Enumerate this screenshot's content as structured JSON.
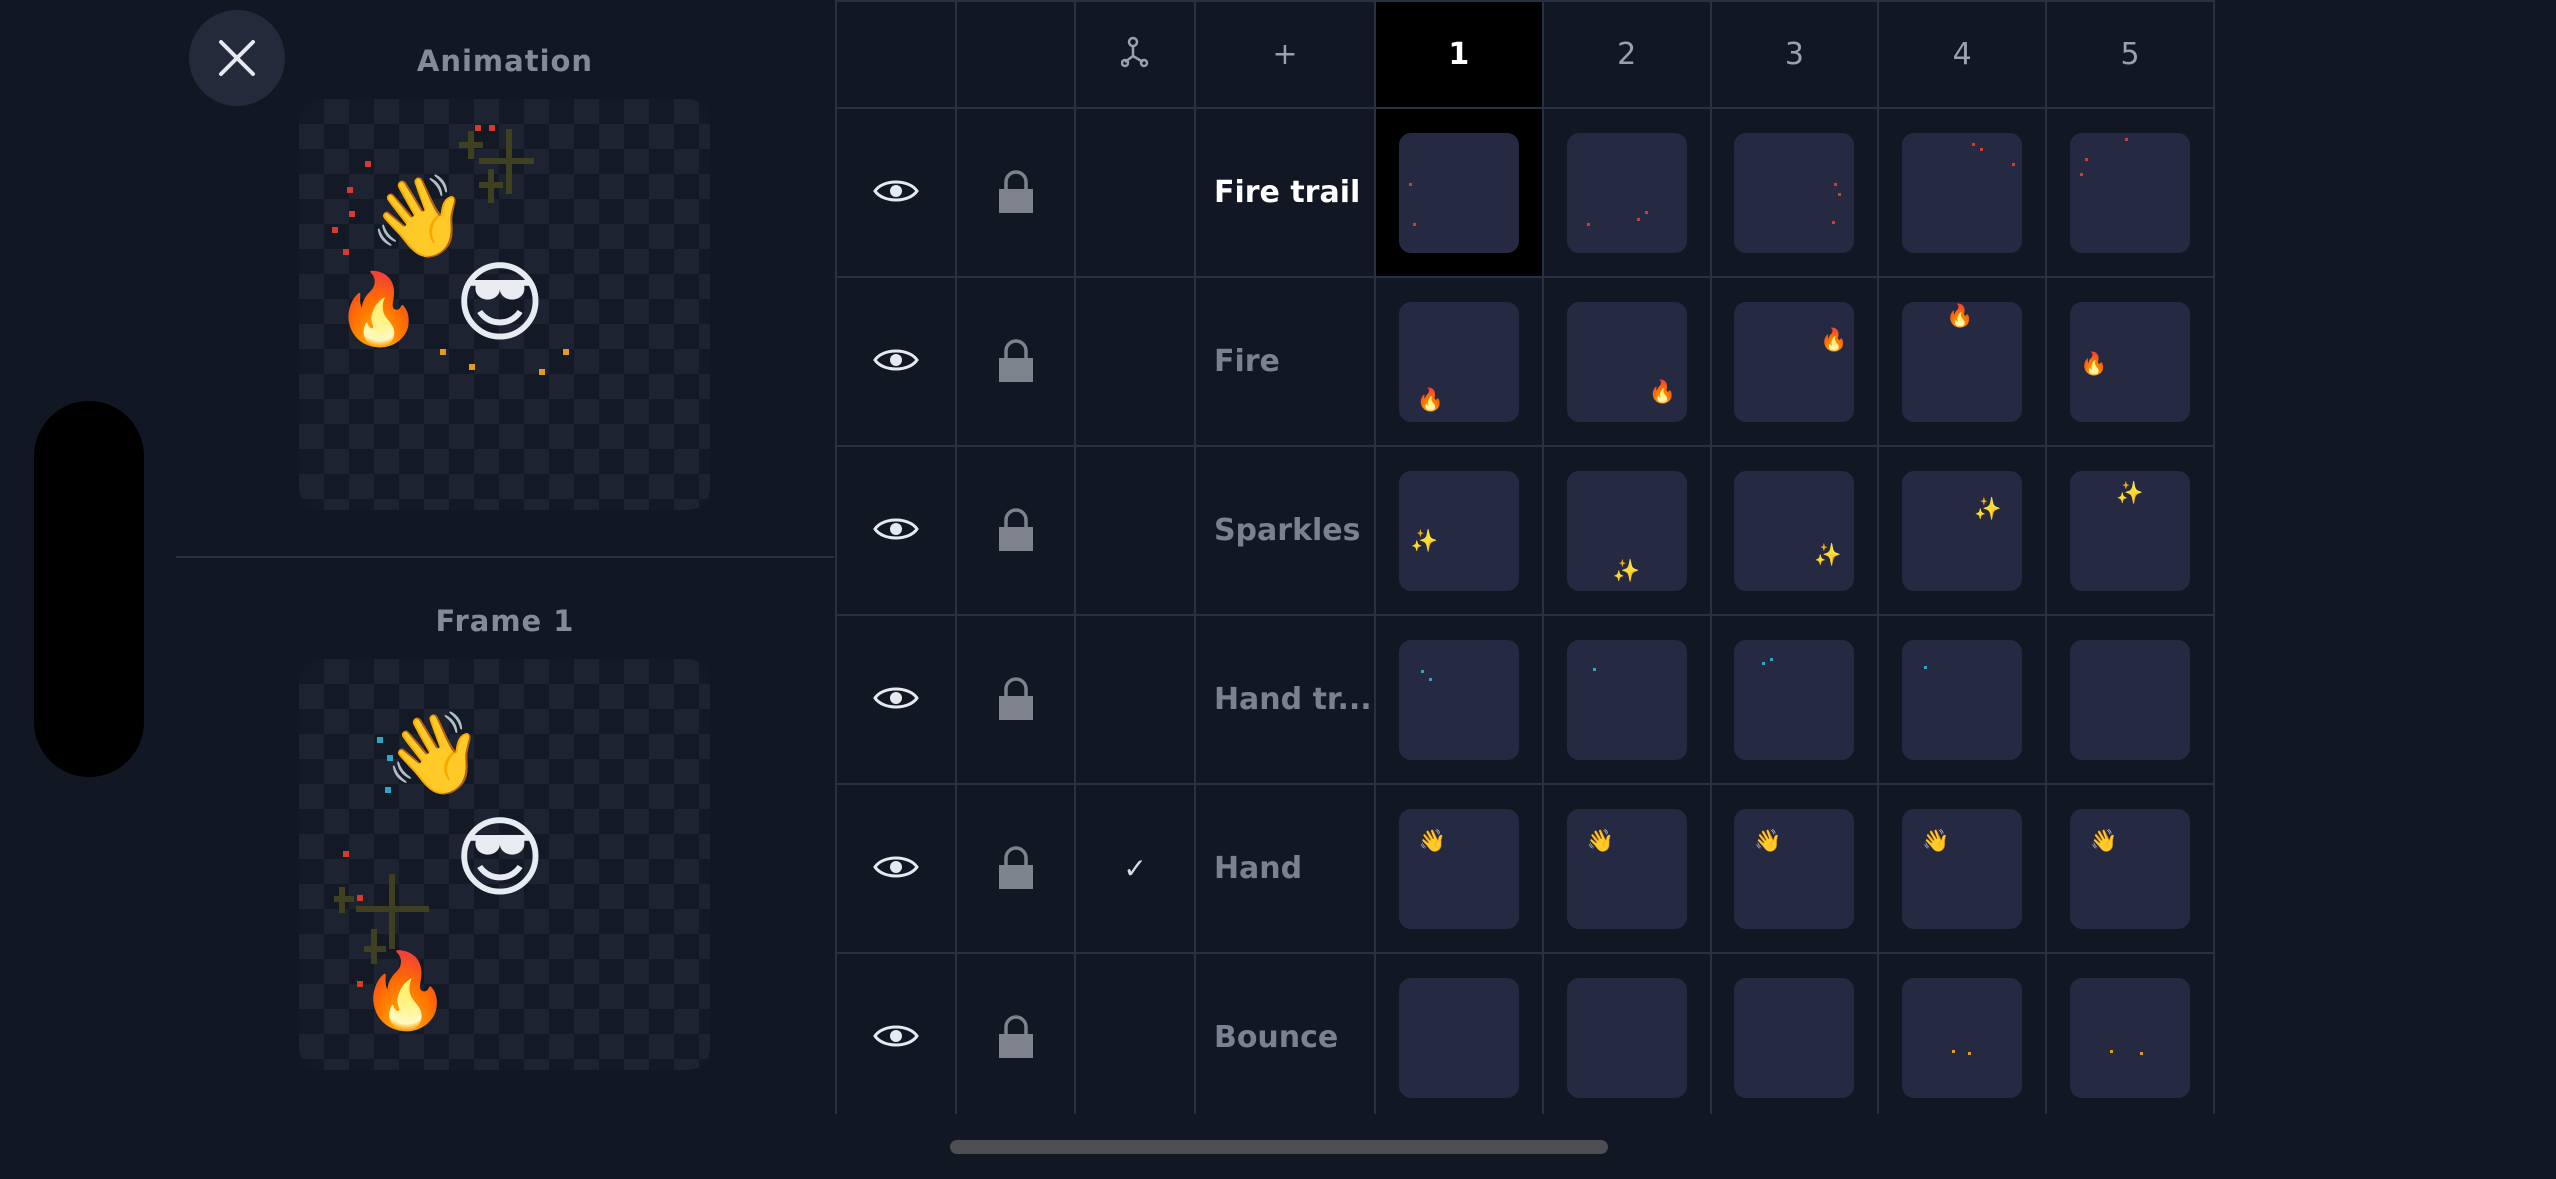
{
  "previews": {
    "animation_title": "Animation",
    "frame_title": "Frame 1"
  },
  "timeline": {
    "frames": [
      "1",
      "2",
      "3",
      "4",
      "5"
    ],
    "active_frame": "1",
    "add_label": "+",
    "layers": [
      {
        "name": "Fire trail",
        "current": true,
        "onion_skin": ""
      },
      {
        "name": "Fire",
        "current": false,
        "onion_skin": ""
      },
      {
        "name": "Sparkles",
        "current": false,
        "onion_skin": ""
      },
      {
        "name": "Hand tr...",
        "current": false,
        "onion_skin": ""
      },
      {
        "name": "Hand",
        "current": false,
        "onion_skin": "✓"
      },
      {
        "name": "Bounce",
        "current": false,
        "onion_skin": ""
      }
    ]
  },
  "icons": {
    "close": "close-icon",
    "visibility": "eye-icon",
    "lock": "lock-icon",
    "onion": "onion-skin-icon"
  },
  "colors": {
    "background": "#111723",
    "cell": "#252942",
    "active_frame": "#000000",
    "grid_line": "#273142"
  }
}
